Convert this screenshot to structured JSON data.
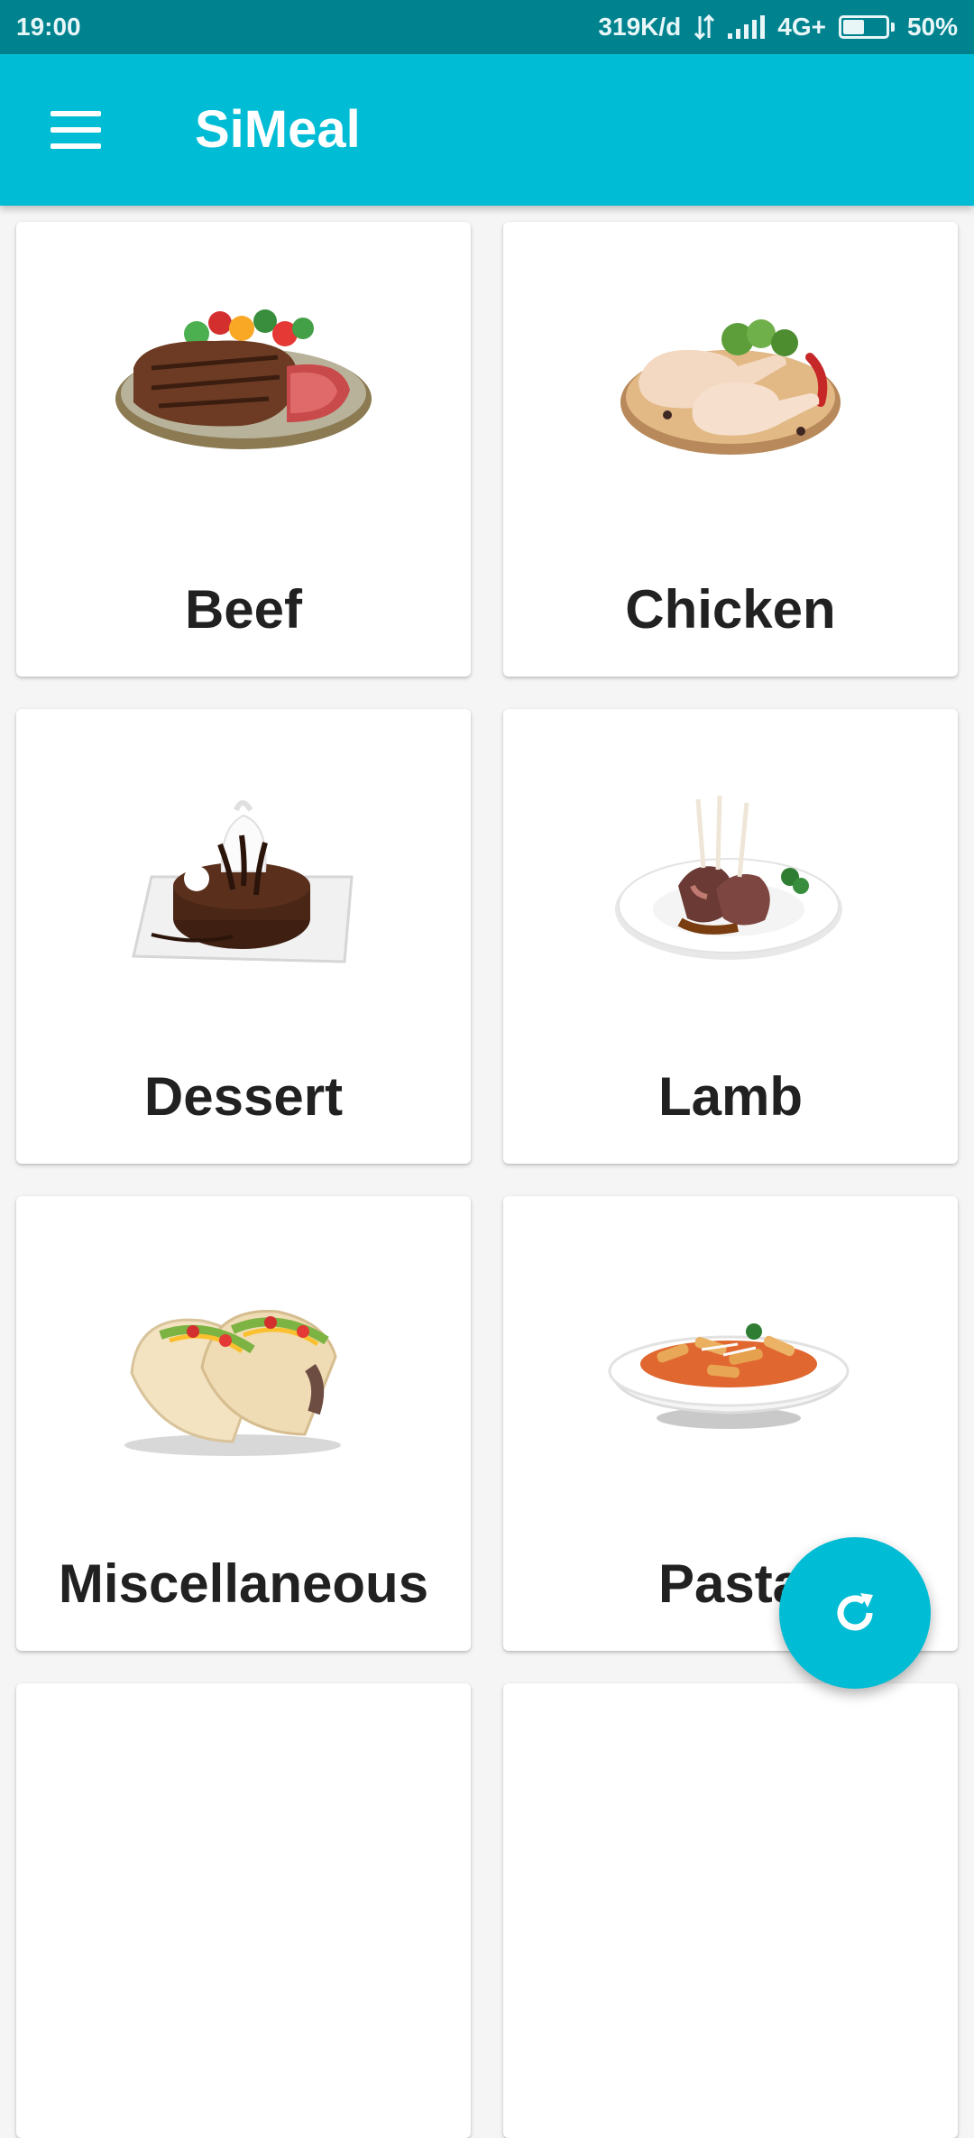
{
  "status_bar": {
    "time": "19:00",
    "data_rate": "319K/d",
    "network": "4G+",
    "battery_percent": "50%",
    "battery_level": 0.5
  },
  "app_bar": {
    "title": "SiMeal",
    "menu_icon": "menu-icon"
  },
  "categories": [
    {
      "label": "Beef",
      "image": "beef-steak-image"
    },
    {
      "label": "Chicken",
      "image": "raw-chicken-image"
    },
    {
      "label": "Dessert",
      "image": "chocolate-dessert-image"
    },
    {
      "label": "Lamb",
      "image": "lamb-chops-image"
    },
    {
      "label": "Miscellaneous",
      "image": "tacos-image"
    },
    {
      "label": "Pasta",
      "image": "pasta-image"
    }
  ],
  "fab": {
    "icon": "refresh-icon"
  },
  "colors": {
    "status_bar": "#00838f",
    "primary": "#00bcd4",
    "background": "#f5f5f5",
    "card": "#ffffff",
    "label_text": "#212121"
  }
}
